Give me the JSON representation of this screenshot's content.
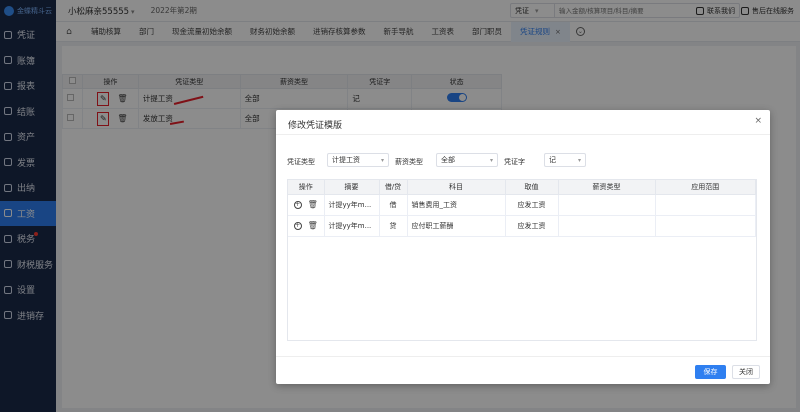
{
  "app": {
    "logo_text": "金蝶精斗云"
  },
  "sidebar": {
    "items": [
      {
        "label": "凭证",
        "icon": "voucher-icon"
      },
      {
        "label": "账簿",
        "icon": "ledger-icon"
      },
      {
        "label": "报表",
        "icon": "report-icon"
      },
      {
        "label": "结账",
        "icon": "closing-icon"
      },
      {
        "label": "资产",
        "icon": "asset-icon"
      },
      {
        "label": "发票",
        "icon": "invoice-icon"
      },
      {
        "label": "出纳",
        "icon": "cashier-icon"
      },
      {
        "label": "工资",
        "icon": "salary-icon",
        "active": true
      },
      {
        "label": "税务",
        "icon": "tax-icon",
        "badge": true
      },
      {
        "label": "财税服务",
        "icon": "service-icon"
      },
      {
        "label": "设置",
        "icon": "settings-icon"
      },
      {
        "label": "进销存",
        "icon": "inventory-icon"
      }
    ]
  },
  "header": {
    "company": "小松麻亲55555",
    "period": "2022年第2期",
    "search_type": "凭证",
    "search_placeholder": "输入金额/核算项目/科目/摘要",
    "contact": "联系我们",
    "support": "售后在线服务"
  },
  "tabs": [
    {
      "label": "辅助核算"
    },
    {
      "label": "部门"
    },
    {
      "label": "现金流量初始余额"
    },
    {
      "label": "财务初始余额"
    },
    {
      "label": "进销存核算参数"
    },
    {
      "label": "新手导航"
    },
    {
      "label": "工资表"
    },
    {
      "label": "部门职员"
    },
    {
      "label": "凭证规则",
      "active": true
    }
  ],
  "main_table": {
    "headers": [
      "操作",
      "凭证类型",
      "薪资类型",
      "凭证字",
      "状态"
    ],
    "rows": [
      {
        "voucher_type": "计提工资",
        "salary_type": "全部",
        "voucher_word": "记",
        "enabled": true
      },
      {
        "voucher_type": "发放工资",
        "salary_type": "全部",
        "voucher_word": "",
        "enabled": true
      }
    ]
  },
  "dialog": {
    "title": "修改凭证模版",
    "fields": {
      "voucher_type_label": "凭证类型",
      "voucher_type_value": "计提工资",
      "salary_type_label": "薪资类型",
      "salary_type_value": "全部",
      "voucher_word_label": "凭证字",
      "voucher_word_value": "记"
    },
    "table": {
      "headers": [
        "操作",
        "摘要",
        "借/贷",
        "科目",
        "取值",
        "薪资类型",
        "应用范围"
      ],
      "rows": [
        {
          "summary": "计提yy年m...",
          "dc": "借",
          "account": "销售费用_工资",
          "value": "应发工资",
          "salary_type": "",
          "scope": ""
        },
        {
          "summary": "计提yy年m...",
          "dc": "贷",
          "account": "应付职工薪酬",
          "value": "应发工资",
          "salary_type": "",
          "scope": ""
        }
      ]
    },
    "save_label": "保存",
    "close_label": "关闭"
  },
  "colors": {
    "accent": "#2f7ff0",
    "sidebar_bg": "#1b2a4a",
    "highlight_red": "#e8202a"
  }
}
